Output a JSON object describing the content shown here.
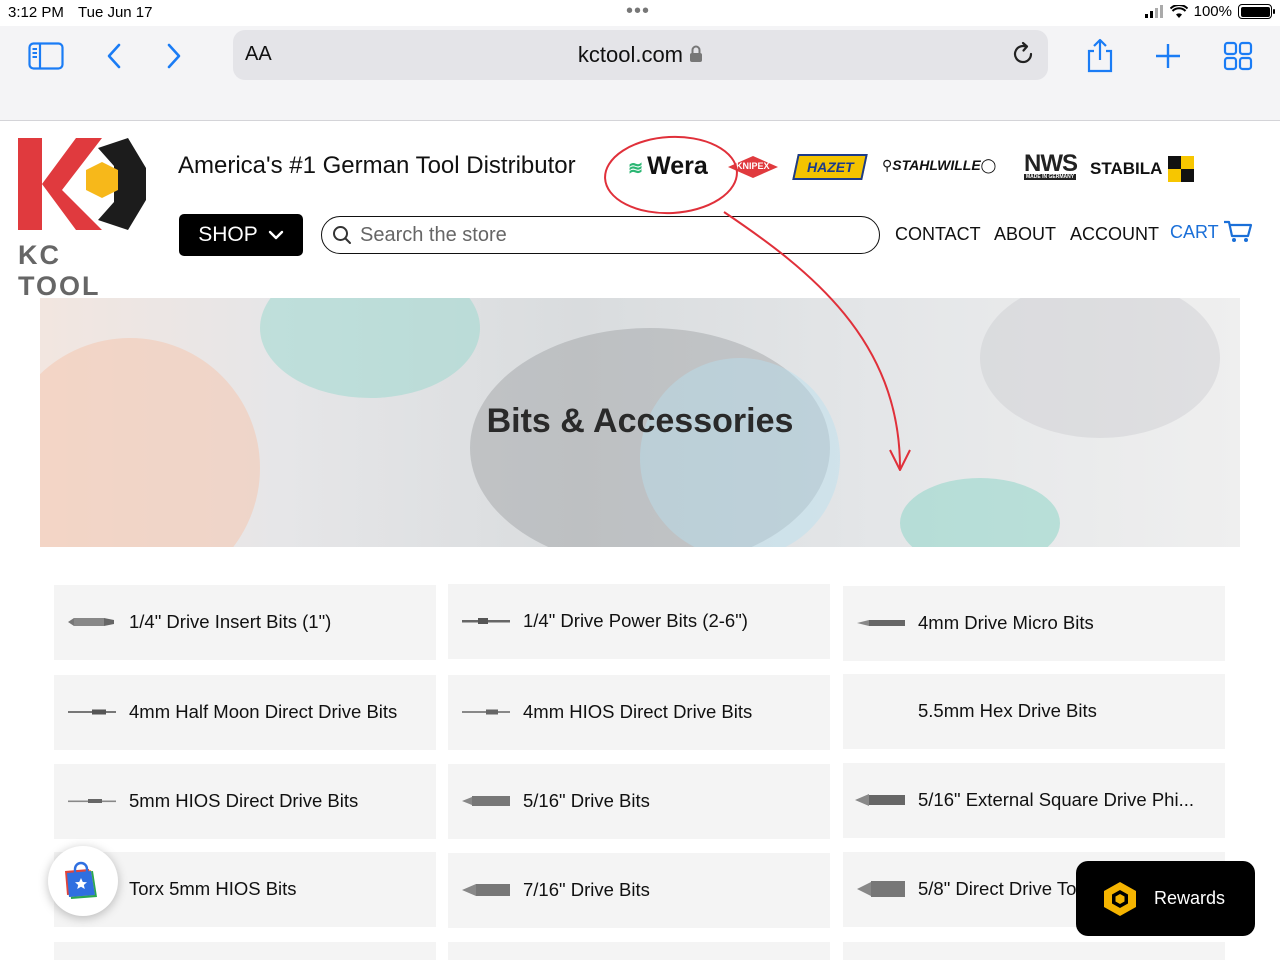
{
  "status_bar": {
    "time": "3:12 PM",
    "date": "Tue Jun 17",
    "battery": "100%",
    "battery_level": 1.0
  },
  "browser": {
    "aa_label": "AA",
    "url": "kctool.com",
    "icons": [
      "sidebar-icon",
      "back-icon",
      "forward-icon",
      "lock-icon",
      "reload-icon",
      "share-icon",
      "new-tab-icon",
      "tabs-icon"
    ],
    "accent": "#1a7cf5"
  },
  "site": {
    "logo_text": "KC TOOL",
    "tagline": "America's #1 German Tool Distributor",
    "brands": [
      "Wera",
      "KNIPEX",
      "HAZET",
      "STAHLWILLE",
      "NWS",
      "MADE IN GERMANY",
      "STABILA"
    ],
    "shop_label": "SHOP",
    "search_placeholder": "Search the store",
    "nav": {
      "contact": "CONTACT",
      "about": "ABOUT",
      "account": "ACCOUNT",
      "cart": "CART"
    },
    "brand_red": "#e03a3e",
    "link_blue": "#1a6fd8"
  },
  "hero": {
    "title": "Bits & Accessories"
  },
  "categories": [
    {
      "label": "1/4\" Drive Insert Bits (1\")"
    },
    {
      "label": "1/4\" Drive Power Bits (2-6\")"
    },
    {
      "label": "4mm Drive Micro Bits"
    },
    {
      "label": "4mm Half Moon Direct Drive Bits"
    },
    {
      "label": "4mm HIOS Direct Drive Bits"
    },
    {
      "label": "5.5mm Hex Drive Bits"
    },
    {
      "label": "5mm HIOS Direct Drive Bits"
    },
    {
      "label": "5/16\" Drive Bits"
    },
    {
      "label": "5/16\" External Square Drive Phi..."
    },
    {
      "label": "Torx 5mm HIOS Bits"
    },
    {
      "label": "7/16\" Drive Bits"
    },
    {
      "label": "5/8\" Direct Drive To"
    }
  ],
  "rewards": {
    "label": "Rewards"
  }
}
